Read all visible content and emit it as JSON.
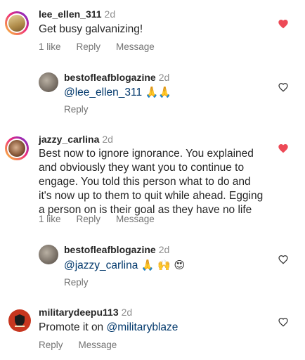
{
  "comments": [
    {
      "username": "lee_ellen_311",
      "time": "2d",
      "text": "Get busy galvanizing!",
      "likes": "1 like",
      "reply": "Reply",
      "message": "Message",
      "liked": true
    },
    {
      "username": "bestofleafblogazine",
      "time": "2d",
      "mention": "@lee_ellen_311",
      "emojis": "🙏🙏",
      "reply": "Reply",
      "liked": false
    },
    {
      "username": "jazzy_carlina",
      "time": "2d",
      "lines": [
        "Best now to ignore ignorance. You explained",
        "and obviously they want you to continue to",
        "engage. You told this person what to do and",
        "it's now up to them to quit while ahead. Egging",
        "a person on is their goal as they have no life"
      ],
      "likes": "1 like",
      "reply": "Reply",
      "message": "Message",
      "liked": true
    },
    {
      "username": "bestofleafblogazine",
      "time": "2d",
      "mention": "@jazzy_carlina",
      "emojis": "🙏 🙌 😍",
      "reply": "Reply",
      "liked": false
    },
    {
      "username": "militarydeepu113",
      "time": "2d",
      "text": "Promote it on",
      "mention": "@militaryblaze",
      "reply": "Reply",
      "message": "Message",
      "liked": false
    }
  ],
  "colors": {
    "liked_heart": "#ed4956",
    "mention": "#00376b",
    "muted": "#737373"
  },
  "icons": {
    "liked": "heart-filled-icon",
    "unliked": "heart-outline-icon"
  }
}
